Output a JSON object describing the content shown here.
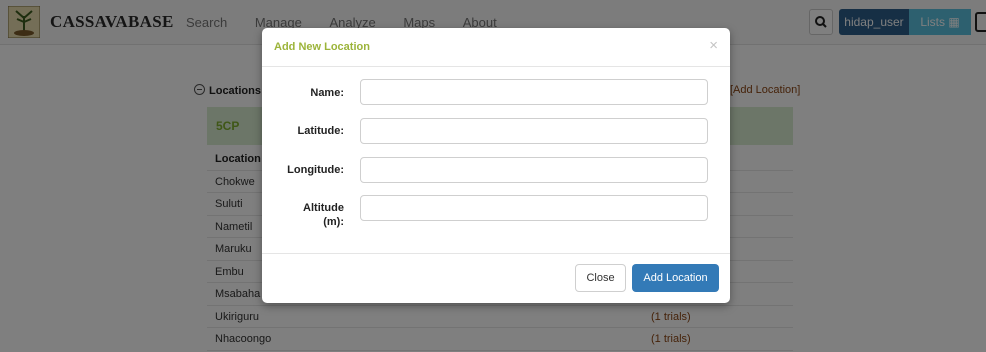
{
  "app": {
    "brand": "CASSAVABASE"
  },
  "nav": {
    "items": [
      "Search",
      "Manage",
      "Analyze",
      "Maps",
      "About"
    ]
  },
  "header_right": {
    "user_label": "hidap_user",
    "lists_label": "Lists ▦"
  },
  "section": {
    "title": "Locations",
    "add_link": "[Add Location]"
  },
  "panel": {
    "group_name": "5CP"
  },
  "table": {
    "header": "Location",
    "rows": [
      {
        "name": "Chokwe",
        "trials": ""
      },
      {
        "name": "Suluti",
        "trials": ""
      },
      {
        "name": "Nametil",
        "trials": ""
      },
      {
        "name": "Maruku",
        "trials": ""
      },
      {
        "name": "Embu",
        "trials": ""
      },
      {
        "name": "Msabaha",
        "trials": ""
      },
      {
        "name": "Ukiriguru",
        "trials": "(1 trials)"
      },
      {
        "name": "Nhacoongo",
        "trials": "(1 trials)"
      }
    ]
  },
  "modal": {
    "title": "Add New Location",
    "close_glyph": "×",
    "fields": [
      {
        "label": "Name:",
        "value": ""
      },
      {
        "label": "Latitude:",
        "value": ""
      },
      {
        "label": "Longitude:",
        "value": ""
      },
      {
        "label": "Altitude (m):",
        "value": ""
      }
    ],
    "buttons": {
      "close": "Close",
      "add": "Add Location"
    }
  }
}
